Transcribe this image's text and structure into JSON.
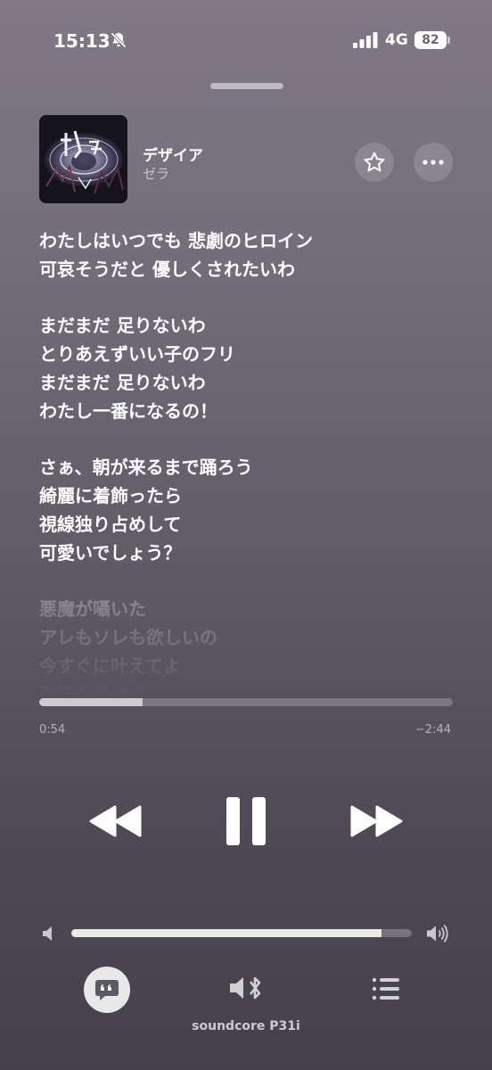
{
  "status_bar": {
    "time": "15:13",
    "network": "4G",
    "battery": "82"
  },
  "now_playing": {
    "title": "デザイア",
    "artist": "ゼラ",
    "favorite_icon": "star-outline-icon",
    "more_icon": "ellipsis-icon"
  },
  "lyrics": {
    "active_stanzas": [
      {
        "lines": [
          "わたしはいつでも 悲劇のヒロイン",
          " 可哀そうだと 優しくされたいわ"
        ]
      },
      {
        "lines": [
          "まだまだ 足りないわ",
          "とりあえずいい子のフリ",
          "まだまだ 足りないわ",
          "わたし一番になるの！"
        ]
      },
      {
        "lines": [
          "さぁ、朝が来るまで踊ろう",
          "綺麗に着飾ったら",
          "視線独り占めして",
          "可愛いでしょう？"
        ]
      }
    ],
    "upcoming_stanzas": [
      {
        "lines": [
          "悪魔が囁いた",
          "アレもソレも欲しいの",
          "今すぐに叶えてよ",
          "魔法をかけて"
        ]
      }
    ]
  },
  "playback": {
    "elapsed": "0:54",
    "remaining": "−2:44",
    "progress": 0.25,
    "volume": 0.91
  },
  "controls": {
    "rewind_icon": "rewind-icon",
    "pause_icon": "pause-icon",
    "forward_icon": "fast-forward-icon",
    "lyrics_icon": "lyrics-quote-icon",
    "airplay_icon": "bluetooth-speaker-icon",
    "queue_icon": "queue-list-icon"
  },
  "output_device": "soundcore P31i"
}
